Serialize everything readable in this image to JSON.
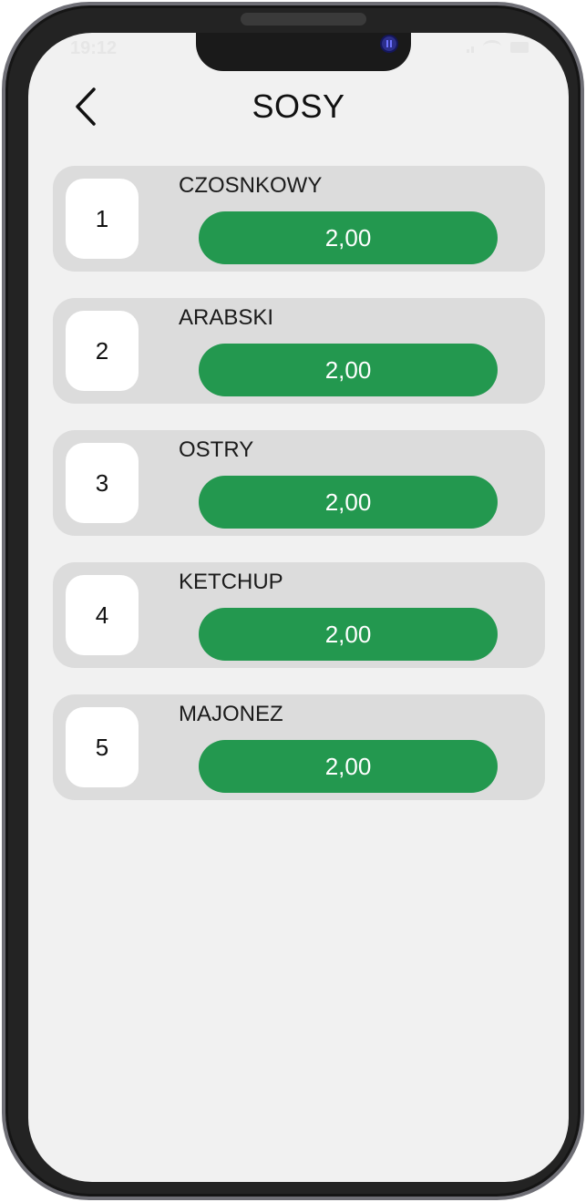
{
  "status_bar": {
    "time": "19:12"
  },
  "header": {
    "title": "SOSY",
    "back_icon": "chevron-left-icon"
  },
  "colors": {
    "background": "#f1f1f1",
    "card": "#dcdcdc",
    "accent": "#23984f",
    "frame": "#232323"
  },
  "items": [
    {
      "number": "1",
      "name": "CZOSNKOWY",
      "price": "2,00"
    },
    {
      "number": "2",
      "name": "ARABSKI",
      "price": "2,00"
    },
    {
      "number": "3",
      "name": "OSTRY",
      "price": "2,00"
    },
    {
      "number": "4",
      "name": "KETCHUP",
      "price": "2,00"
    },
    {
      "number": "5",
      "name": "MAJONEZ",
      "price": "2,00"
    }
  ]
}
